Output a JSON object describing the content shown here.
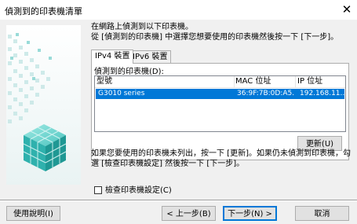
{
  "window": {
    "title": "偵測到的印表機清單",
    "close_glyph": "✕"
  },
  "intro": {
    "line1": "在網路上偵測到以下印表機。",
    "line2": "從 [偵測到的印表機] 中選擇您想要使用的印表機然後按一下 [下一步]。"
  },
  "tabs": [
    {
      "label": "IPv4 裝置",
      "active": true
    },
    {
      "label": "IPv6 裝置",
      "active": false
    }
  ],
  "printer_list": {
    "label": "偵測到的印表機(D):",
    "columns": [
      "型號",
      "MAC 位址",
      "IP 位址"
    ],
    "rows": [
      {
        "model": "G3010 series",
        "mac": "36:9F:7B:0D:A5...",
        "ip": "192.168.11....",
        "selected": true
      }
    ],
    "selection_color": "#0078d7",
    "update_label": "更新(U)"
  },
  "hint": "如果您要使用的印表機未列出，按一下 [更新]。如果仍未偵測到印表機，勾選 [檢查印表機設定] 然後按一下 [下一步]。",
  "check_printer_settings": {
    "label": "檢查印表機設定(C)",
    "checked": false
  },
  "footer": {
    "help_label": "使用說明(I)",
    "back_label": "< 上一步(B)",
    "next_label": "下一步(N) >",
    "cancel_label": "取消"
  }
}
